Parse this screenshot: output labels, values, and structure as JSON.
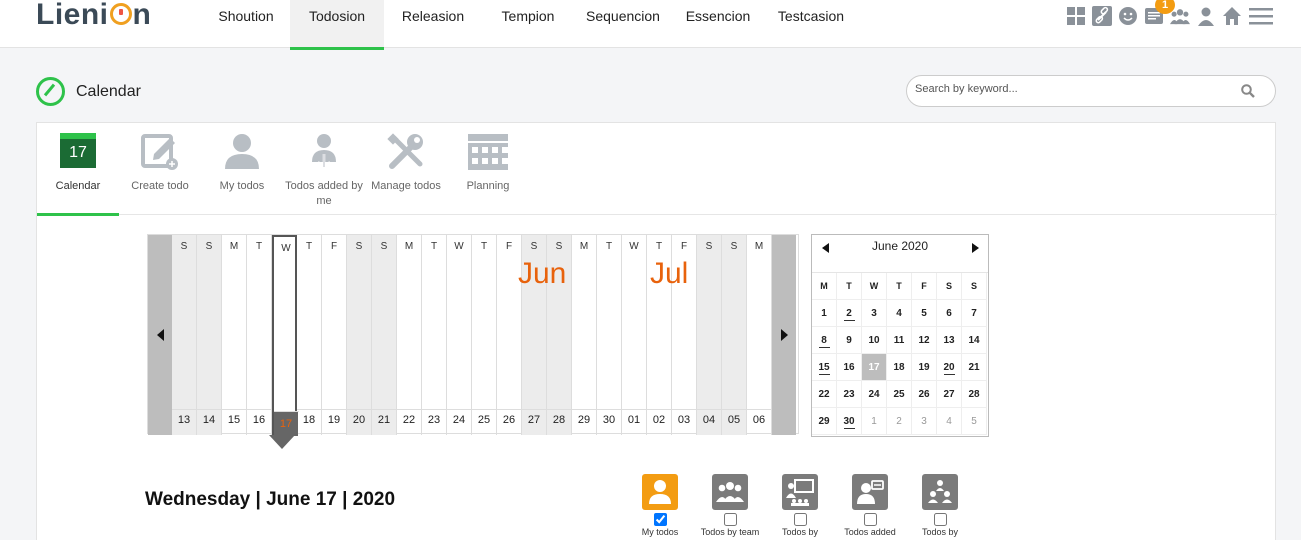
{
  "app": {
    "logo_text": "Lieni",
    "logo_tail": "n"
  },
  "nav": {
    "items": [
      "Shoution",
      "Todosion",
      "Releasion",
      "Tempion",
      "Sequencion",
      "Essencion",
      "Testcasion"
    ],
    "active_index": 1
  },
  "topbar": {
    "notification_count": "1",
    "icons": [
      "grid-icon",
      "link-icon",
      "smiley-icon",
      "notes-icon",
      "team-icon",
      "user-icon",
      "home-icon",
      "menu-icon"
    ]
  },
  "page": {
    "title": "Calendar",
    "search_placeholder": "Search by keyword..."
  },
  "toolbar": {
    "calendar_day": "17",
    "items": [
      "Calendar",
      "Create todo",
      "My todos",
      "Todos added by me",
      "Manage todos",
      "Planning"
    ]
  },
  "strip": {
    "weekdays": [
      "S",
      "S",
      "M",
      "T",
      "W",
      "T",
      "F",
      "S",
      "S",
      "M",
      "T",
      "W",
      "T",
      "F",
      "S",
      "S",
      "M",
      "T",
      "W",
      "T",
      "F",
      "S",
      "S",
      "M"
    ],
    "days": [
      "13",
      "14",
      "15",
      "16",
      "17",
      "18",
      "19",
      "20",
      "21",
      "22",
      "23",
      "24",
      "25",
      "26",
      "27",
      "28",
      "29",
      "30",
      "01",
      "02",
      "03",
      "04",
      "05",
      "06"
    ],
    "selected_index": 4,
    "month_labels": [
      "Jun",
      "Jul"
    ]
  },
  "mini_calendar": {
    "title": "June 2020",
    "headers": [
      "M",
      "T",
      "W",
      "T",
      "F",
      "S",
      "S"
    ],
    "weeks": [
      [
        "1",
        "2",
        "3",
        "4",
        "5",
        "6",
        "7"
      ],
      [
        "8",
        "9",
        "10",
        "11",
        "12",
        "13",
        "14"
      ],
      [
        "15",
        "16",
        "17",
        "18",
        "19",
        "20",
        "21"
      ],
      [
        "22",
        "23",
        "24",
        "25",
        "26",
        "27",
        "28"
      ],
      [
        "29",
        "30",
        "1",
        "2",
        "3",
        "4",
        "5"
      ]
    ],
    "today": "17"
  },
  "date_heading": "Wednesday | June 17 | 2020",
  "filters": [
    {
      "label": "My todos",
      "checked": true
    },
    {
      "label": "Todos by team",
      "checked": false
    },
    {
      "label": "Todos by",
      "checked": false
    },
    {
      "label": "Todos added",
      "checked": false
    },
    {
      "label": "Todos by",
      "checked": false
    }
  ],
  "colors": {
    "accent_green": "#2ec24a",
    "accent_orange": "#e8620c",
    "badge_orange": "#f39c12"
  }
}
